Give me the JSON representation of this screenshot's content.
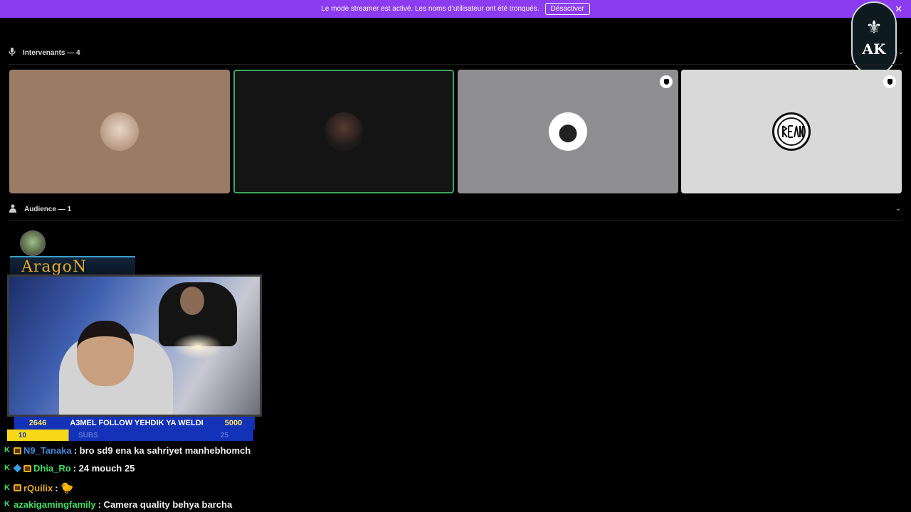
{
  "banner": {
    "text": "Le mode streamer est activé. Les noms d’utilisateur ont été tronqués.",
    "button": "Désactiver",
    "close": "✕"
  },
  "logo": {
    "mark": "AK"
  },
  "speakers": {
    "label": "Intervenants — 4",
    "tiles": [
      {
        "bg": "#9a7b66"
      },
      {
        "bg": "#141414"
      },
      {
        "bg": "#8e8e90"
      },
      {
        "bg": "#d9d9d9"
      }
    ]
  },
  "audience": {
    "label": "Audience — 1"
  },
  "stream": {
    "name": "AragoN",
    "ticker": {
      "followers": "2646",
      "text": "A3MEL FOLLOW YEHDIK YA WELDI",
      "goal": "5000",
      "subs_count": "10",
      "subs_text": "SUBS",
      "subs_goal": "25"
    }
  },
  "chat": [
    {
      "user": "N9_Tanaka",
      "color": "#3f8ad8",
      "text": ": bro sd9 ena ka sahriyet manhebhomch"
    },
    {
      "user": "Dhia_Ro",
      "color": "#3ce05e",
      "text": ": 24 mouch 25"
    },
    {
      "user": "rQuilix",
      "color": "#e6a920",
      "text": ": "
    },
    {
      "user": "azakigamingfamily",
      "color": "#3ce05e",
      "text": ": Camera quality behya barcha"
    }
  ]
}
